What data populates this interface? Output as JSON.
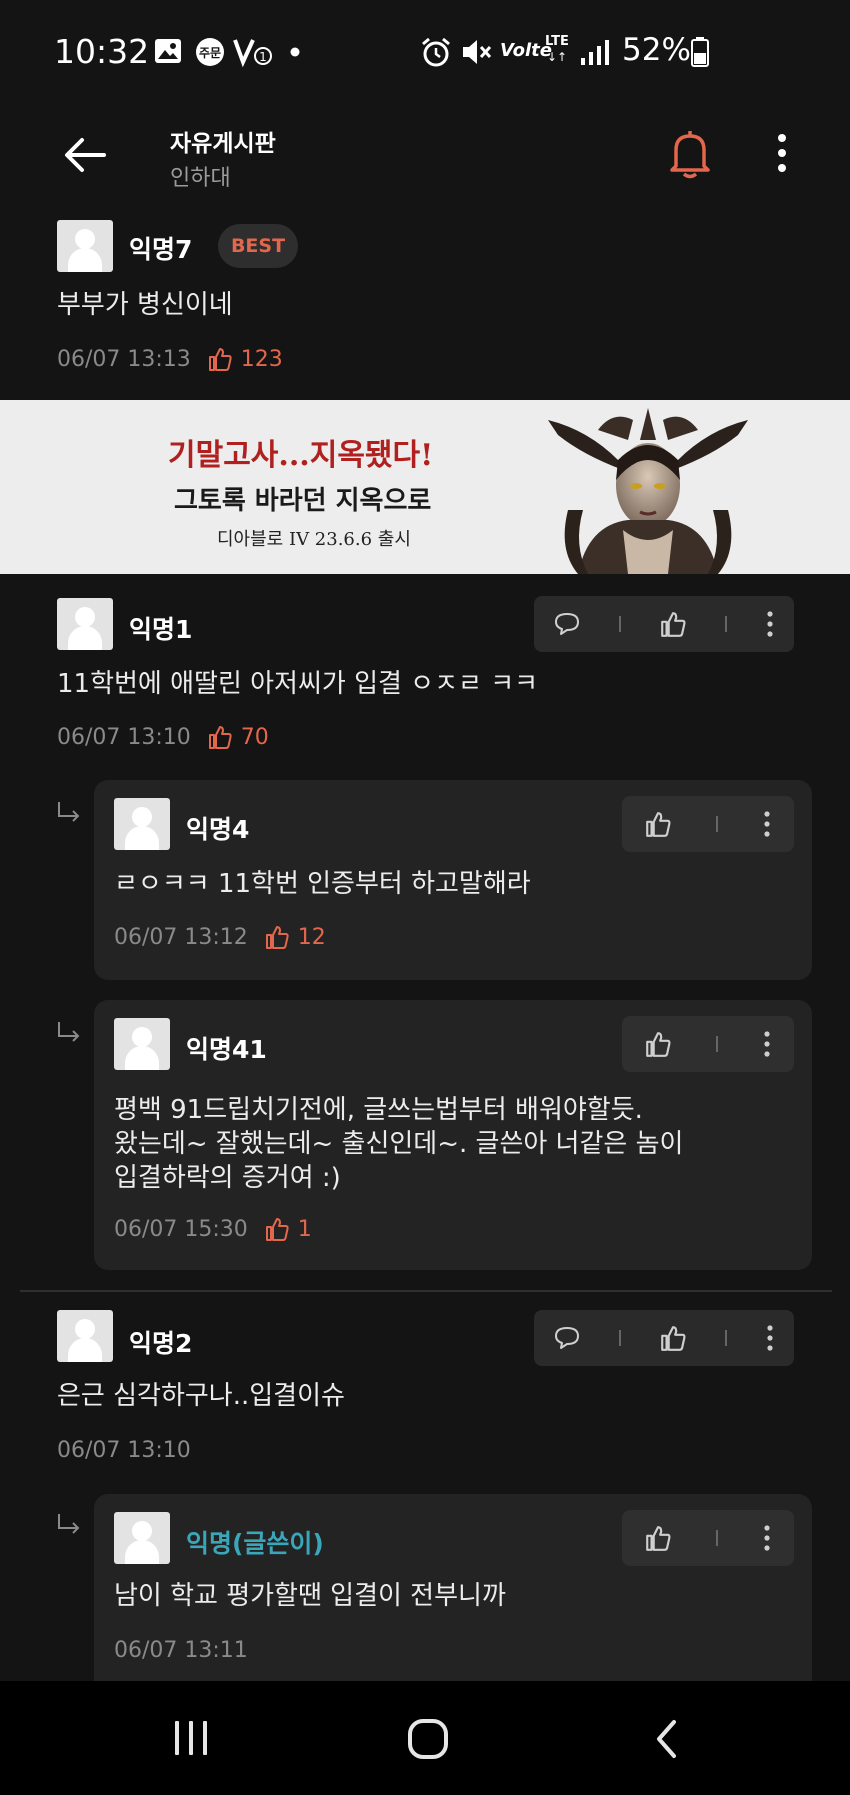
{
  "status_bar": {
    "time": "10:32",
    "order_badge": "주문",
    "volte": "Volte",
    "lte": "LTE",
    "battery": "52%"
  },
  "header": {
    "title": "자유게시판",
    "subtitle": "인하대"
  },
  "best_comment": {
    "author": "익명7",
    "badge": "BEST",
    "text": "부부가 병신이네",
    "date": "06/07 13:13",
    "likes": "123"
  },
  "ad_banner": {
    "line1": "기말고사...지옥됐다!",
    "line2": "그토록 바라던 지옥으로",
    "line3": "디아블로 IV 23.6.6 출시"
  },
  "comments": [
    {
      "author": "익명1",
      "text": "11학번에 애딸린 아저씨가 입결 ㅇㅈㄹ ㅋㅋ",
      "date": "06/07 13:10",
      "likes": "70",
      "replies": [
        {
          "author": "익명4",
          "text": "ㄹㅇㅋㅋ 11학번 인증부터 하고말해라",
          "date": "06/07 13:12",
          "likes": "12"
        },
        {
          "author": "익명41",
          "text_lines": [
            "평백 91드립치기전에, 글쓰는법부터 배워야할듯.",
            "왔는데~ 잘했는데~ 출신인데~. 글쓴아 너같은 놈이",
            "입결하락의 증거여 :)"
          ],
          "date": "06/07 15:30",
          "likes": "1"
        }
      ]
    },
    {
      "author": "익명2",
      "text": "은근 심각하구나..입결이슈",
      "date": "06/07 13:10",
      "replies": [
        {
          "author": "익명(글쓴이)",
          "text": "남이 학교 평가할땐 입결이 전부니까",
          "date": "06/07 13:11"
        }
      ]
    }
  ],
  "icons": [
    "back-arrow-icon",
    "bell-icon",
    "more-vertical-icon",
    "comment-icon",
    "thumbs-up-icon",
    "reply-arrow-icon"
  ],
  "colors": {
    "accent": "#e2674c",
    "op_name": "#3aa6b9",
    "background": "#141414",
    "card": "#232323"
  }
}
